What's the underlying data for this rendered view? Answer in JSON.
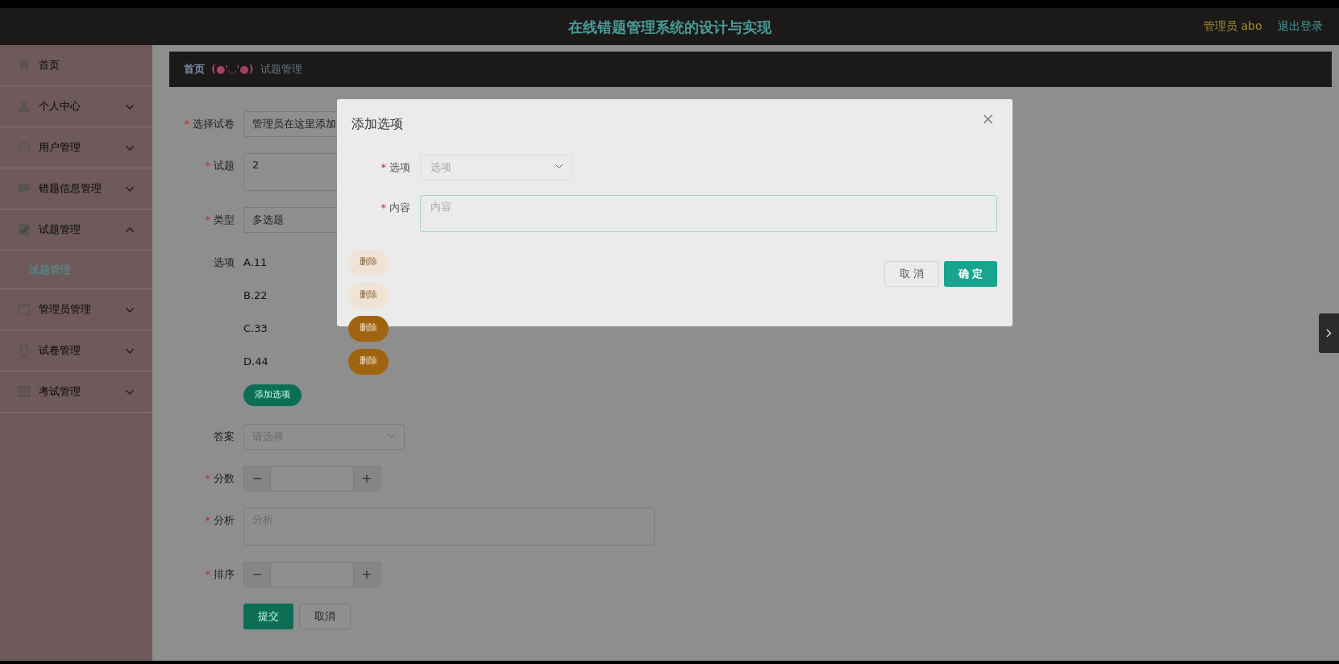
{
  "header": {
    "title": "在线错题管理系统的设计与实现",
    "user": "管理员 abo",
    "logout": "退出登录"
  },
  "sidebar": {
    "items": [
      {
        "label": "首页",
        "kind": "link"
      },
      {
        "label": "个人中心",
        "kind": "menu",
        "expanded": false
      },
      {
        "label": "用户管理",
        "kind": "menu",
        "expanded": false
      },
      {
        "label": "错题信息管理",
        "kind": "menu",
        "expanded": false
      },
      {
        "label": "试题管理",
        "kind": "menu",
        "expanded": true,
        "children": [
          {
            "label": "试题管理",
            "selected": true
          }
        ]
      },
      {
        "label": "管理员管理",
        "kind": "menu",
        "expanded": false
      },
      {
        "label": "试卷管理",
        "kind": "menu",
        "expanded": false
      },
      {
        "label": "考试管理",
        "kind": "menu",
        "expanded": false
      }
    ]
  },
  "breadcrumb": [
    {
      "text": "首页",
      "kind": "home"
    },
    {
      "text": "(●'◡'●)",
      "kind": "separator"
    },
    {
      "text": "试题管理",
      "kind": "current"
    }
  ],
  "form": {
    "fields": [
      {
        "kind": "select",
        "label": "选择试卷",
        "required_mark": "*",
        "value": "管理员在这里添加"
      },
      {
        "kind": "textarea",
        "label": "试题",
        "required_mark": "*",
        "value": "2"
      },
      {
        "kind": "select",
        "label": "类型",
        "required_mark": "*",
        "value": "多选题"
      },
      {
        "kind": "options",
        "label": "选项",
        "items": [
          {
            "text": "A.11",
            "delete": "删除",
            "covered": true
          },
          {
            "text": "B.22",
            "delete": "删除",
            "covered": true
          },
          {
            "text": "C.33",
            "delete": "删除",
            "covered": false
          },
          {
            "text": "D.44",
            "delete": "删除",
            "covered": false
          }
        ],
        "add_button": "添加选项"
      },
      {
        "kind": "dropdown",
        "label": "答案",
        "placeholder": "请选择"
      },
      {
        "kind": "number",
        "label": "分数",
        "required_mark": "*",
        "minus": "−",
        "plus": "+"
      },
      {
        "kind": "textarea",
        "label": "分析",
        "required_mark": "*",
        "placeholder": "分析"
      },
      {
        "kind": "number",
        "label": "排序",
        "required_mark": "*",
        "minus": "−",
        "plus": "+"
      }
    ],
    "buttons": [
      {
        "label": "提交",
        "kind": "primary"
      },
      {
        "label": "取消",
        "kind": "secondary"
      }
    ]
  },
  "modal": {
    "title": "添加选项",
    "close": "×",
    "fields": [
      {
        "kind": "dropdown",
        "label": "选项",
        "required_mark": "*",
        "placeholder": "选项"
      },
      {
        "kind": "textarea",
        "label": "内容",
        "required_mark": "*",
        "placeholder": "内容"
      }
    ],
    "buttons": [
      {
        "label": "取消",
        "kind": "secondary"
      },
      {
        "label": "确定",
        "kind": "primary"
      }
    ]
  }
}
